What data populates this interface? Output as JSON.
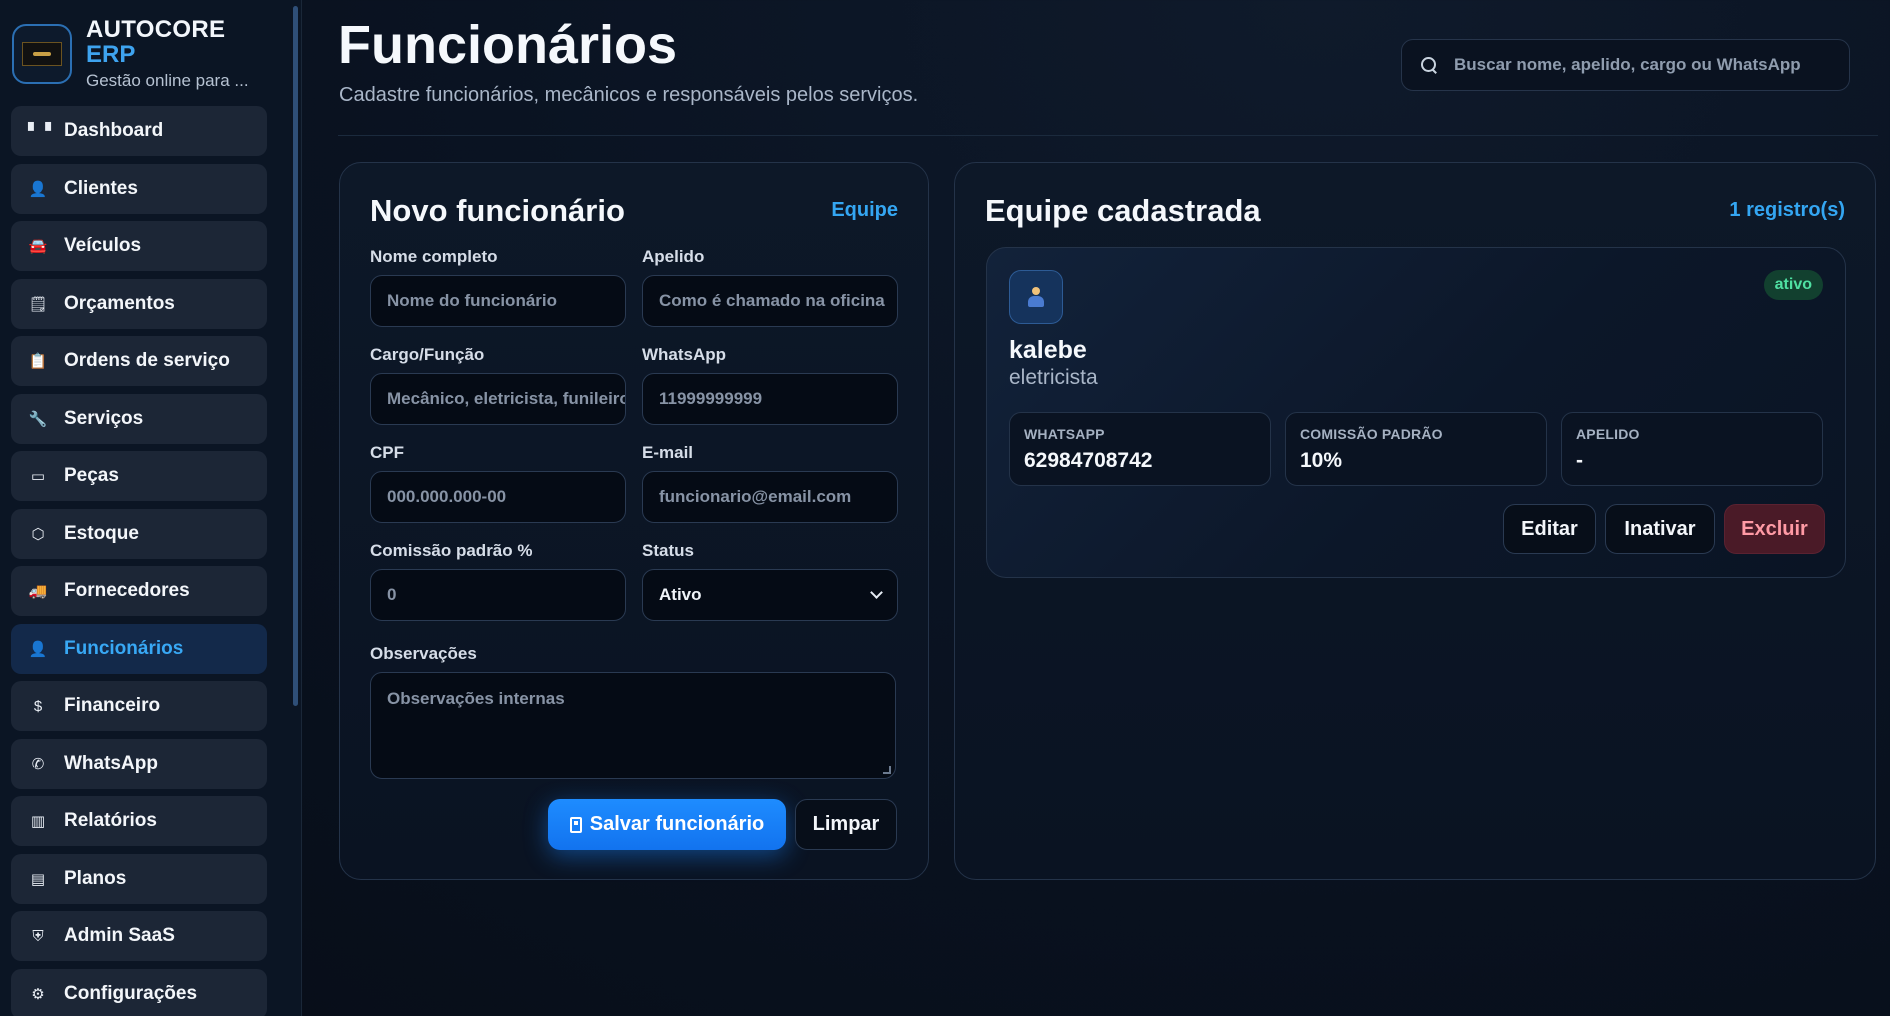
{
  "brand": {
    "title_line1": "AUTOCORE",
    "title_line2": "ERP",
    "subtitle": "Gestão online para ..."
  },
  "sidebar": {
    "items": [
      {
        "label": "Dashboard",
        "icon": "dashboard-icon",
        "glyph": "▘▝",
        "active": false
      },
      {
        "label": "Clientes",
        "icon": "user-icon",
        "glyph": "👤",
        "active": false
      },
      {
        "label": "Veículos",
        "icon": "car-icon",
        "glyph": "🚘",
        "active": false
      },
      {
        "label": "Orçamentos",
        "icon": "document-icon",
        "glyph": "🗒",
        "active": false
      },
      {
        "label": "Ordens de serviço",
        "icon": "clipboard-icon",
        "glyph": "📋",
        "active": false
      },
      {
        "label": "Serviços",
        "icon": "wrench-icon",
        "glyph": "🔧",
        "active": false
      },
      {
        "label": "Peças",
        "icon": "parts-icon",
        "glyph": "▭",
        "active": false
      },
      {
        "label": "Estoque",
        "icon": "box-icon",
        "glyph": "⬡",
        "active": false
      },
      {
        "label": "Fornecedores",
        "icon": "truck-icon",
        "glyph": "🚚",
        "active": false
      },
      {
        "label": "Funcionários",
        "icon": "worker-icon",
        "glyph": "👤",
        "active": true
      },
      {
        "label": "Financeiro",
        "icon": "money-icon",
        "glyph": "$",
        "active": false
      },
      {
        "label": "WhatsApp",
        "icon": "whatsapp-icon",
        "glyph": "✆",
        "active": false
      },
      {
        "label": "Relatórios",
        "icon": "bar-chart-icon",
        "glyph": "▥",
        "active": false
      },
      {
        "label": "Planos",
        "icon": "card-icon",
        "glyph": "▤",
        "active": false
      },
      {
        "label": "Admin SaaS",
        "icon": "shield-icon",
        "glyph": "⛨",
        "active": false
      },
      {
        "label": "Configurações",
        "icon": "gear-icon",
        "glyph": "⚙",
        "active": false
      }
    ]
  },
  "header": {
    "title": "Funcionários",
    "subtitle": "Cadastre funcionários, mecânicos e responsáveis pelos serviços.",
    "search_placeholder": "Buscar nome, apelido, cargo ou WhatsApp"
  },
  "form": {
    "title": "Novo funcionário",
    "link": "Equipe",
    "fields": {
      "nome": {
        "label": "Nome completo",
        "placeholder": "Nome do funcionário"
      },
      "apelido": {
        "label": "Apelido",
        "placeholder": "Como é chamado na oficina"
      },
      "cargo": {
        "label": "Cargo/Função",
        "placeholder": "Mecânico, eletricista, funileiro"
      },
      "whatsapp": {
        "label": "WhatsApp",
        "placeholder": "11999999999"
      },
      "cpf": {
        "label": "CPF",
        "placeholder": "000.000.000-00"
      },
      "email": {
        "label": "E-mail",
        "placeholder": "funcionario@email.com"
      },
      "comissao": {
        "label": "Comissão padrão %",
        "placeholder": "0"
      },
      "status": {
        "label": "Status",
        "value": "Ativo"
      },
      "observacoes": {
        "label": "Observações",
        "placeholder": "Observações internas"
      }
    },
    "save_label": "Salvar funcionário",
    "clear_label": "Limpar"
  },
  "team": {
    "title": "Equipe cadastrada",
    "count_label": "1 registro(s)",
    "employees": [
      {
        "name": "kalebe",
        "role": "eletricista",
        "status": "ativo",
        "whatsapp_label": "WHATSAPP",
        "whatsapp": "62984708742",
        "commission_label": "COMISSÃO PADRÃO",
        "commission": "10%",
        "nickname_label": "APELIDO",
        "nickname": "-",
        "edit_label": "Editar",
        "deactivate_label": "Inativar",
        "delete_label": "Excluir"
      }
    ]
  },
  "colors": {
    "accent": "#34a6f2",
    "primary_button": "#1e8cff",
    "status_active": "#4fe0a2",
    "delete": "#4a1a27"
  }
}
